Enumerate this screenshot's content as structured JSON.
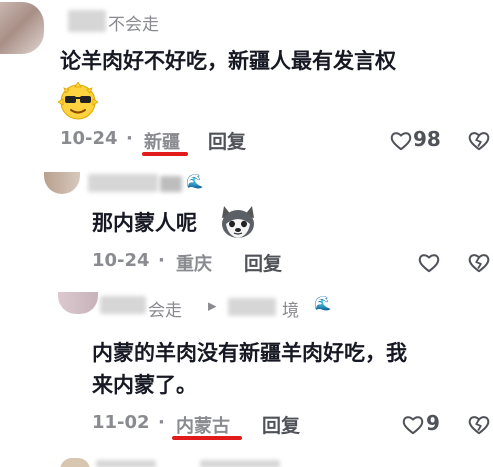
{
  "comments": [
    {
      "username_visible": "不会走",
      "text": "论羊肉好不好吃，新疆人最有发言权",
      "emoji": "sunglasses-emoji",
      "date": "10-24",
      "separator": "·",
      "location": "新疆",
      "reply_label": "回复",
      "likes": "98"
    },
    {
      "text": "那内蒙人呢",
      "emoji": "husky-dog-emoji",
      "date": "10-24",
      "separator": "·",
      "location": "重庆",
      "reply_label": "回复"
    },
    {
      "username_visible": "会走",
      "reply_arrow": "▸",
      "reply_target_visible": "境",
      "text_line1": "内蒙的羊肉没有新疆羊肉好吃，我",
      "text_line2": "来内蒙了。",
      "date": "11-02",
      "separator": "·",
      "location": "内蒙古",
      "reply_label": "回复",
      "likes": "9"
    }
  ],
  "colors": {
    "text": "#161823",
    "meta": "#8a8b91",
    "underline": "#e11b1b",
    "wave": "#3aa0e8"
  }
}
